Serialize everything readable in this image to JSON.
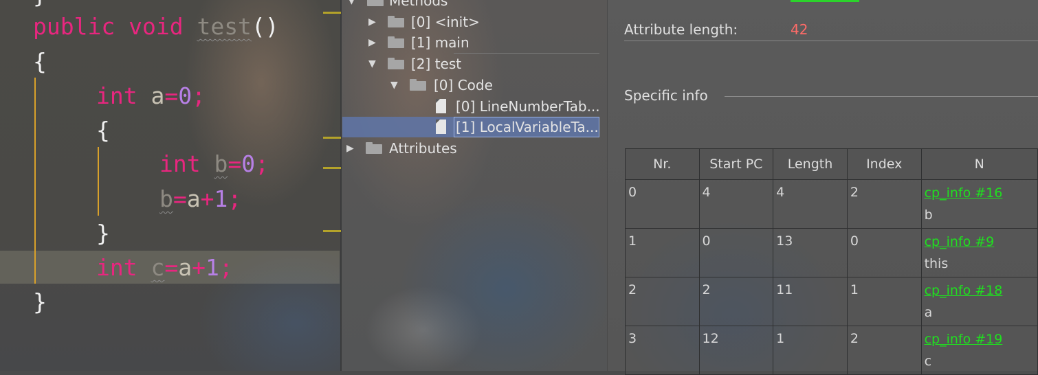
{
  "editor": {
    "line_top_brace": "}",
    "kw_public": "public",
    "kw_void": "void",
    "method_name": "test",
    "parens": "()",
    "open_brace_1": "{",
    "kw_int_a": "int",
    "var_a": "a",
    "eq_a": "=",
    "val_a": "0",
    "semi_a": ";",
    "open_brace_2": "{",
    "kw_int_b": "int",
    "var_b": "b",
    "eq_b": "=",
    "val_b": "0",
    "semi_b": ";",
    "assign_b_var": "b",
    "assign_b_eq": "=",
    "assign_b_a": "a",
    "assign_b_plus": "+",
    "assign_b_one": "1",
    "assign_b_semi": ";",
    "close_brace_2": "}",
    "kw_int_c": "int",
    "var_c": "c",
    "eq_c": "=",
    "c_a": "a",
    "c_plus": "+",
    "c_one": "1",
    "c_semi": ";",
    "close_brace_1": "}"
  },
  "tree": {
    "methods_label": "Methods",
    "items": [
      {
        "label": "[0] <init>"
      },
      {
        "label": "[1] main"
      },
      {
        "label": "[2] test"
      },
      {
        "label": "[0] Code"
      },
      {
        "label": "[0] LineNumberTab..."
      },
      {
        "label": "[1] LocalVariableTa..."
      },
      {
        "label": "Attributes"
      }
    ]
  },
  "details": {
    "attr_length_label": "Attribute length:",
    "attr_length_value": "42",
    "specific_info_label": "Specific info",
    "table": {
      "columns": [
        "Nr.",
        "Start PC",
        "Length",
        "Index",
        "N"
      ],
      "rows": [
        {
          "nr": "0",
          "start_pc": "4",
          "length": "4",
          "index": "2",
          "ref": "cp_info #16",
          "name": "b"
        },
        {
          "nr": "1",
          "start_pc": "0",
          "length": "13",
          "index": "0",
          "ref": "cp_info #9",
          "name": "this"
        },
        {
          "nr": "2",
          "start_pc": "2",
          "length": "11",
          "index": "1",
          "ref": "cp_info #18",
          "name": "a"
        },
        {
          "nr": "3",
          "start_pc": "12",
          "length": "1",
          "index": "2",
          "ref": "cp_info #19",
          "name": "c"
        }
      ]
    }
  },
  "colors": {
    "keyword": "#e8267f",
    "number": "#b780e6",
    "link": "#1fe01f",
    "attr_value": "#ff6b68",
    "selection": "#5f76a8"
  }
}
